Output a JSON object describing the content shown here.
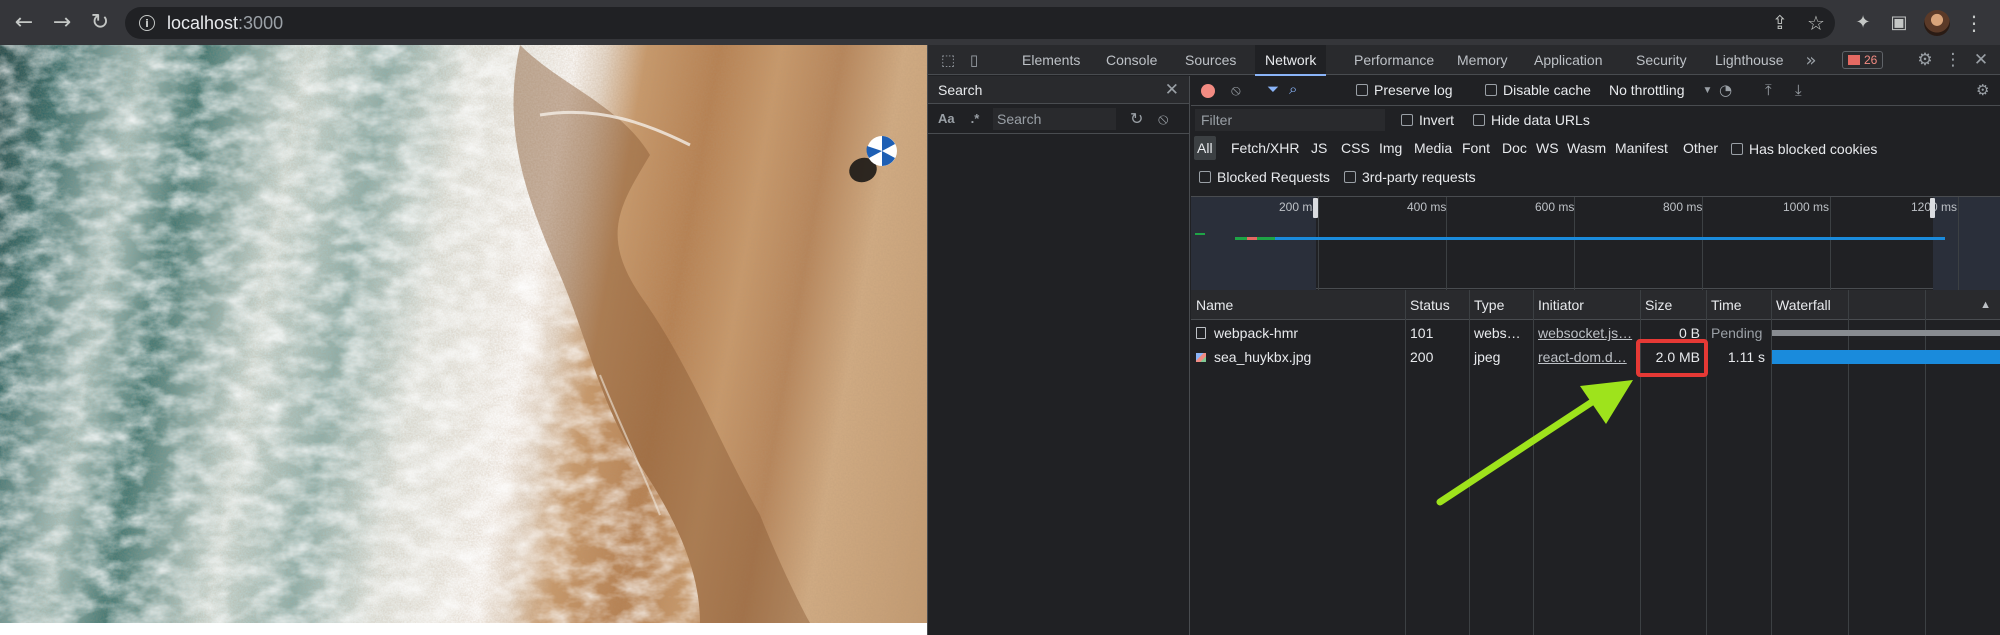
{
  "browser": {
    "url_host": "localhost",
    "url_port": ":3000",
    "icons": [
      "back-arrow-icon",
      "forward-arrow-icon",
      "reload-icon",
      "info-icon",
      "share-icon",
      "star-icon",
      "extensions-icon",
      "side-panel-icon",
      "profile-avatar",
      "menu-dots-icon"
    ]
  },
  "devtools": {
    "tabs": [
      "Elements",
      "Console",
      "Sources",
      "Network",
      "Performance",
      "Memory",
      "Application",
      "Security",
      "Lighthouse"
    ],
    "active_tab": "Network",
    "more_tabs": "»",
    "error_count": "26",
    "search": {
      "title": "Search",
      "case_toggle": "Aa",
      "regex_toggle": ".*",
      "placeholder": "Search"
    },
    "network": {
      "preserve_log": "Preserve log",
      "disable_cache": "Disable cache",
      "throttling": "No throttling",
      "filter_placeholder": "Filter",
      "invert": "Invert",
      "hide_data_urls": "Hide data URLs",
      "types": [
        "All",
        "Fetch/XHR",
        "JS",
        "CSS",
        "Img",
        "Media",
        "Font",
        "Doc",
        "WS",
        "Wasm",
        "Manifest",
        "Other"
      ],
      "active_type": "All",
      "has_blocked_cookies": "Has blocked cookies",
      "blocked_requests": "Blocked Requests",
      "third_party": "3rd-party requests",
      "overview_ticks": [
        "200 ms",
        "400 ms",
        "600 ms",
        "800 ms",
        "1000 ms",
        "1200 ms"
      ],
      "columns": [
        "Name",
        "Status",
        "Type",
        "Initiator",
        "Size",
        "Time",
        "Waterfall"
      ],
      "rows": [
        {
          "name": "webpack-hmr",
          "status": "101",
          "type": "webs…",
          "initiator": "websocket.js…",
          "size": "0 B",
          "time": "Pending"
        },
        {
          "name": "sea_huykbx.jpg",
          "status": "200",
          "type": "jpeg",
          "initiator": "react-dom.d…",
          "size": "2.0 MB",
          "time": "1.11 s"
        }
      ]
    }
  },
  "annotation": {
    "highlight_color": "#e53935",
    "arrow_color": "#9ee31c"
  }
}
